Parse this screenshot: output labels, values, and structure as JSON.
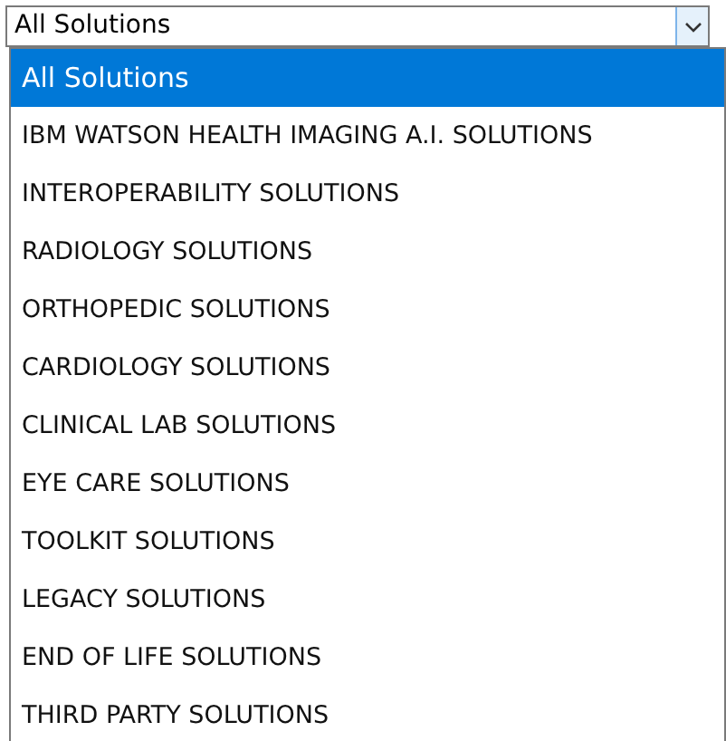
{
  "select": {
    "value": "All Solutions"
  },
  "options": [
    {
      "label": "All Solutions",
      "selected": true
    },
    {
      "label": "IBM WATSON HEALTH IMAGING A.I. SOLUTIONS",
      "selected": false
    },
    {
      "label": "INTEROPERABILITY SOLUTIONS",
      "selected": false
    },
    {
      "label": "RADIOLOGY SOLUTIONS",
      "selected": false
    },
    {
      "label": "ORTHOPEDIC SOLUTIONS",
      "selected": false
    },
    {
      "label": "CARDIOLOGY SOLUTIONS",
      "selected": false
    },
    {
      "label": "CLINICAL LAB SOLUTIONS",
      "selected": false
    },
    {
      "label": "EYE CARE SOLUTIONS",
      "selected": false
    },
    {
      "label": "TOOLKIT SOLUTIONS",
      "selected": false
    },
    {
      "label": "LEGACY SOLUTIONS",
      "selected": false
    },
    {
      "label": "END OF LIFE SOLUTIONS",
      "selected": false
    },
    {
      "label": "THIRD PARTY SOLUTIONS",
      "selected": false
    }
  ]
}
